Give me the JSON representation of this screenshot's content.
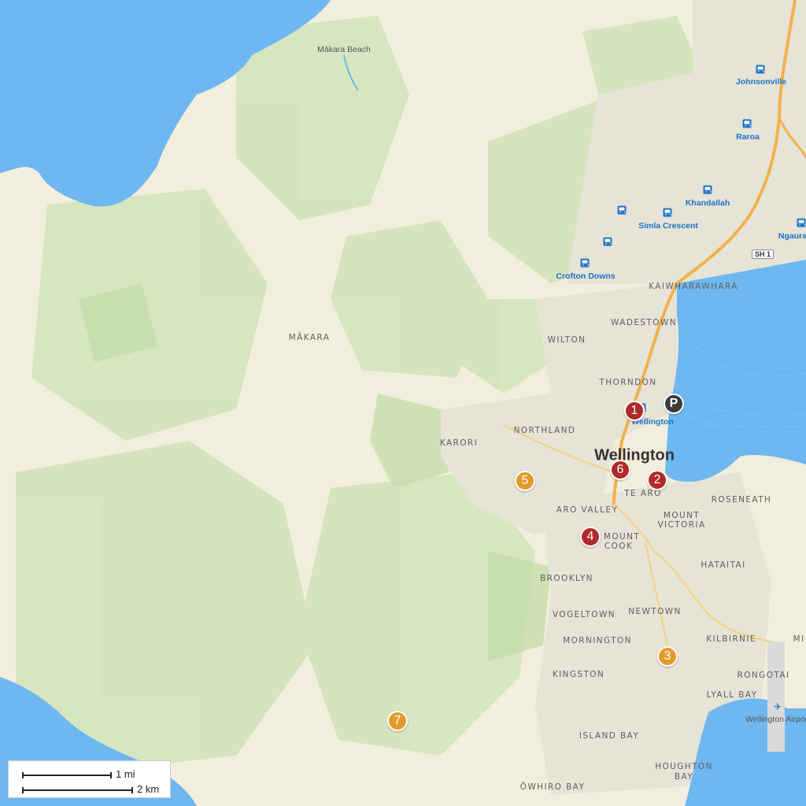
{
  "colors": {
    "water": "#6fb7f0",
    "land": "#f2eedd",
    "park": "#cfe2b8",
    "urban": "#e4e1d6",
    "highway": "#f2b14c",
    "marker_red": "#b02a2a",
    "marker_orange": "#e39a2c",
    "marker_dark": "#3b3b3b",
    "transit": "#1e74c9"
  },
  "city_label": "Wellington",
  "district_labels": [
    "MĀKARA",
    "KARORI",
    "NORTHLAND",
    "KAIWHARAWHARA",
    "WADESTOWN",
    "WILTON",
    "THORNDON",
    "TE ARO",
    "ARO VALLEY",
    "MOUNT",
    "VICTORIA",
    "MOUNT",
    "COOK",
    "ROSENEATH",
    "HATAITAI",
    "BROOKLYN",
    "NEWTOWN",
    "VOGELTOWN",
    "MORNINGTON",
    "KILBIRNIE",
    "KINGSTON",
    "RONGOTAI",
    "LYALL BAY",
    "ISLAND BAY",
    "HOUGHTON",
    "BAY",
    "ŌWHIRO BAY",
    "MI"
  ],
  "poi_labels": [
    "Mākara Beach",
    "Wellington Airport"
  ],
  "transit_stations": [
    "Johnsonville",
    "Raroa",
    "Khandallah",
    "Simla Crescent",
    "Crofton Downs",
    "Wellington",
    "Ngaura"
  ],
  "road_shield": "SH 1",
  "markers": [
    {
      "label": "1",
      "color": "red"
    },
    {
      "label": "2",
      "color": "red"
    },
    {
      "label": "3",
      "color": "orange"
    },
    {
      "label": "4",
      "color": "red"
    },
    {
      "label": "5",
      "color": "orange"
    },
    {
      "label": "6",
      "color": "red"
    },
    {
      "label": "7",
      "color": "orange"
    },
    {
      "label": "P",
      "color": "dark",
      "icon": "parking-icon"
    }
  ],
  "scale": {
    "mi_label": "1 mi",
    "km_label": "2 km"
  }
}
